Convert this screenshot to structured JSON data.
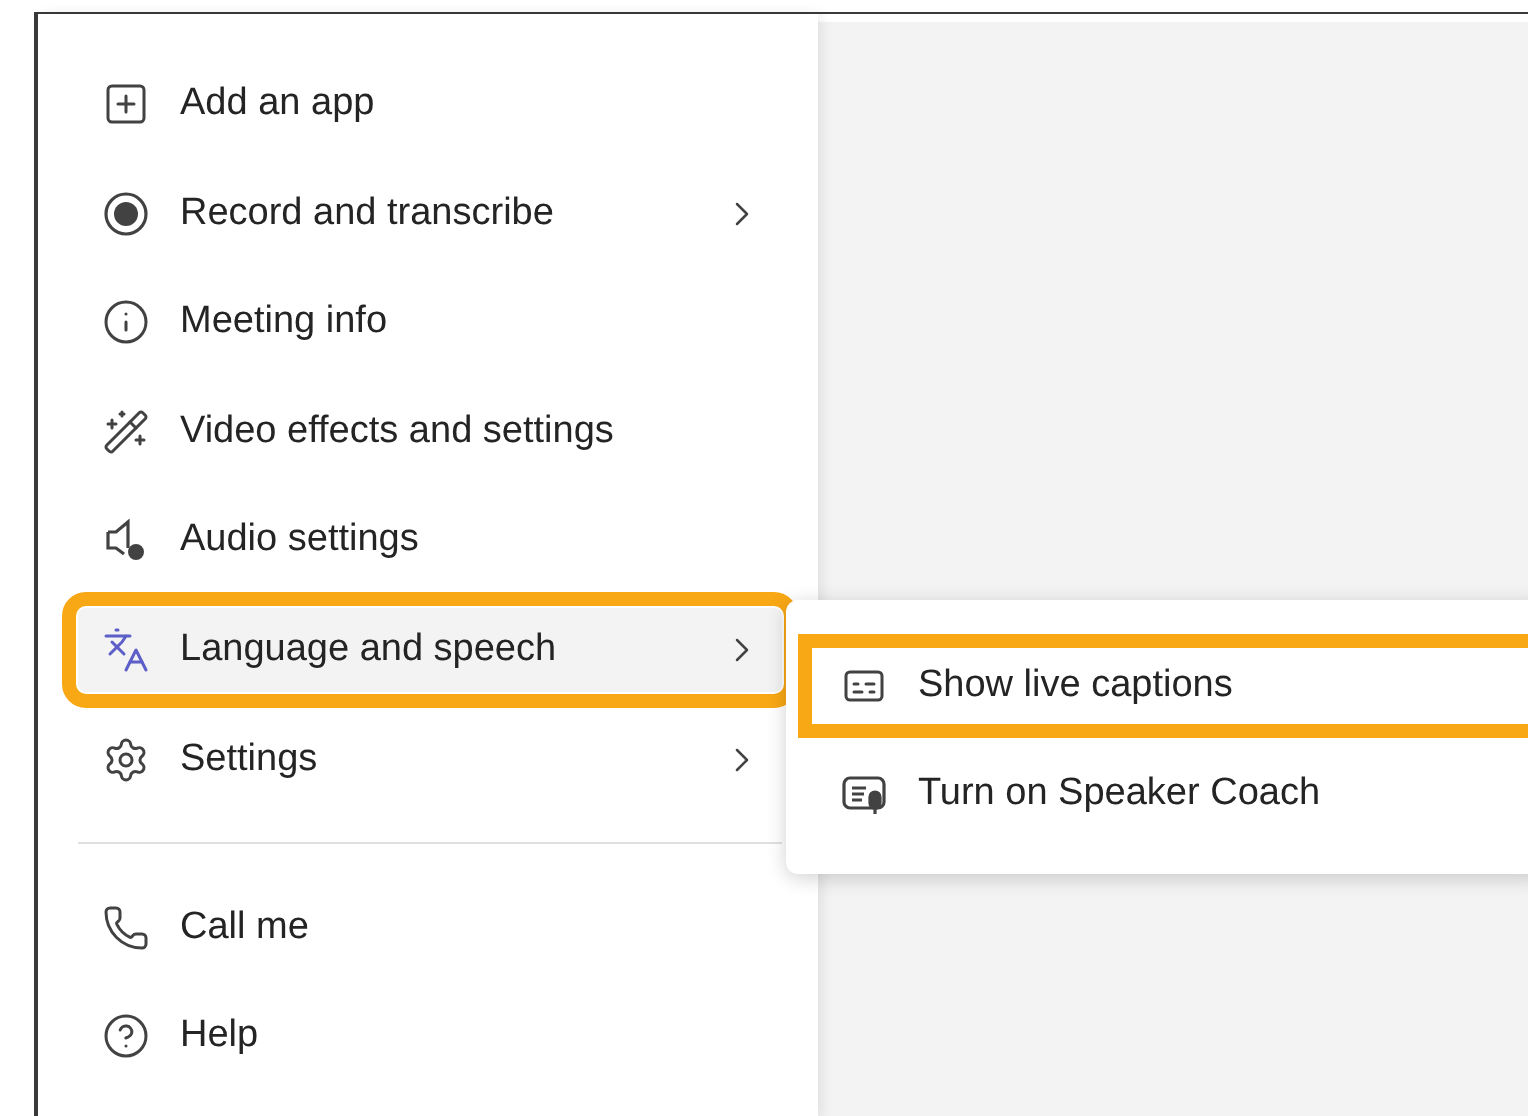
{
  "menu": {
    "items": [
      {
        "kind": "item",
        "label": "Add an app",
        "submenu": false,
        "selected": false,
        "highlighted": false
      },
      {
        "kind": "item",
        "label": "Record and transcribe",
        "submenu": true,
        "selected": false,
        "highlighted": false
      },
      {
        "kind": "item",
        "label": "Meeting info",
        "submenu": false,
        "selected": false,
        "highlighted": false
      },
      {
        "kind": "item",
        "label": "Video effects and settings",
        "submenu": false,
        "selected": false,
        "highlighted": false
      },
      {
        "kind": "item",
        "label": "Audio settings",
        "submenu": false,
        "selected": false,
        "highlighted": false
      },
      {
        "kind": "item",
        "label": "Language and speech",
        "submenu": true,
        "selected": true,
        "highlighted": true
      },
      {
        "kind": "item",
        "label": "Settings",
        "submenu": true,
        "selected": false,
        "highlighted": false
      },
      {
        "kind": "divider"
      },
      {
        "kind": "item",
        "label": "Call me",
        "submenu": false,
        "selected": false,
        "highlighted": false
      },
      {
        "kind": "item",
        "label": "Help",
        "submenu": false,
        "selected": false,
        "highlighted": false
      }
    ]
  },
  "submenu": {
    "items": [
      {
        "label": "Show live captions",
        "highlighted": true
      },
      {
        "label": "Turn on Speaker Coach",
        "highlighted": false
      }
    ]
  }
}
